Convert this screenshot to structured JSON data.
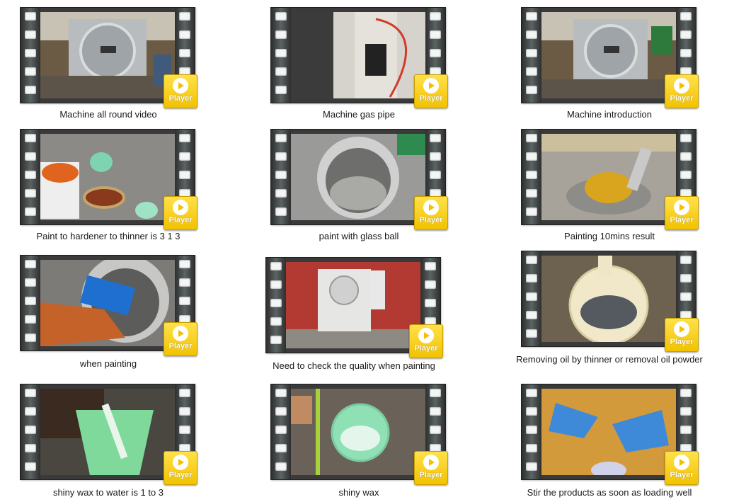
{
  "videos": [
    {
      "caption": "Machine all round video",
      "player": "Player"
    },
    {
      "caption": "Machine gas pipe",
      "player": "Player"
    },
    {
      "caption": "Machine introduction",
      "player": "Player"
    },
    {
      "caption": "Paint to hardener to thinner is 3 1 3",
      "player": "Player"
    },
    {
      "caption": "paint with glass ball",
      "player": "Player"
    },
    {
      "caption": "Painting 10mins result",
      "player": "Player"
    },
    {
      "caption": "when painting",
      "player": "Player"
    },
    {
      "caption": "Need to check the quality when painting",
      "player": "Player"
    },
    {
      "caption": "Removing oil by thinner or removal oil powder",
      "player": "Player"
    },
    {
      "caption": "shiny wax to water is 1 to 3",
      "player": "Player"
    },
    {
      "caption": "shiny wax",
      "player": "Player"
    },
    {
      "caption": "Stir the products as soon as loading well",
      "player": "Player"
    }
  ],
  "colors": {
    "player_badge": "#f2c200",
    "film_strip": "#3a3a3a",
    "film_hole": "#f4f6f6"
  }
}
